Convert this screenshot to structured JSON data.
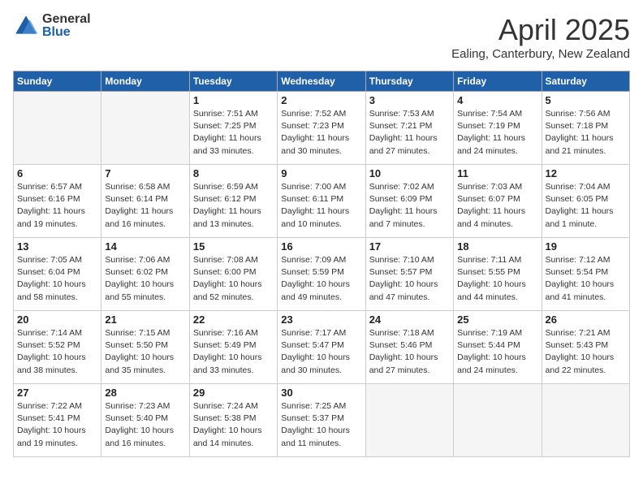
{
  "header": {
    "logo_general": "General",
    "logo_blue": "Blue",
    "month": "April 2025",
    "location": "Ealing, Canterbury, New Zealand"
  },
  "weekdays": [
    "Sunday",
    "Monday",
    "Tuesday",
    "Wednesday",
    "Thursday",
    "Friday",
    "Saturday"
  ],
  "weeks": [
    [
      {
        "day": "",
        "sunrise": "",
        "sunset": "",
        "daylight": ""
      },
      {
        "day": "",
        "sunrise": "",
        "sunset": "",
        "daylight": ""
      },
      {
        "day": "1",
        "sunrise": "Sunrise: 7:51 AM",
        "sunset": "Sunset: 7:25 PM",
        "daylight": "Daylight: 11 hours and 33 minutes."
      },
      {
        "day": "2",
        "sunrise": "Sunrise: 7:52 AM",
        "sunset": "Sunset: 7:23 PM",
        "daylight": "Daylight: 11 hours and 30 minutes."
      },
      {
        "day": "3",
        "sunrise": "Sunrise: 7:53 AM",
        "sunset": "Sunset: 7:21 PM",
        "daylight": "Daylight: 11 hours and 27 minutes."
      },
      {
        "day": "4",
        "sunrise": "Sunrise: 7:54 AM",
        "sunset": "Sunset: 7:19 PM",
        "daylight": "Daylight: 11 hours and 24 minutes."
      },
      {
        "day": "5",
        "sunrise": "Sunrise: 7:56 AM",
        "sunset": "Sunset: 7:18 PM",
        "daylight": "Daylight: 11 hours and 21 minutes."
      }
    ],
    [
      {
        "day": "6",
        "sunrise": "Sunrise: 6:57 AM",
        "sunset": "Sunset: 6:16 PM",
        "daylight": "Daylight: 11 hours and 19 minutes."
      },
      {
        "day": "7",
        "sunrise": "Sunrise: 6:58 AM",
        "sunset": "Sunset: 6:14 PM",
        "daylight": "Daylight: 11 hours and 16 minutes."
      },
      {
        "day": "8",
        "sunrise": "Sunrise: 6:59 AM",
        "sunset": "Sunset: 6:12 PM",
        "daylight": "Daylight: 11 hours and 13 minutes."
      },
      {
        "day": "9",
        "sunrise": "Sunrise: 7:00 AM",
        "sunset": "Sunset: 6:11 PM",
        "daylight": "Daylight: 11 hours and 10 minutes."
      },
      {
        "day": "10",
        "sunrise": "Sunrise: 7:02 AM",
        "sunset": "Sunset: 6:09 PM",
        "daylight": "Daylight: 11 hours and 7 minutes."
      },
      {
        "day": "11",
        "sunrise": "Sunrise: 7:03 AM",
        "sunset": "Sunset: 6:07 PM",
        "daylight": "Daylight: 11 hours and 4 minutes."
      },
      {
        "day": "12",
        "sunrise": "Sunrise: 7:04 AM",
        "sunset": "Sunset: 6:05 PM",
        "daylight": "Daylight: 11 hours and 1 minute."
      }
    ],
    [
      {
        "day": "13",
        "sunrise": "Sunrise: 7:05 AM",
        "sunset": "Sunset: 6:04 PM",
        "daylight": "Daylight: 10 hours and 58 minutes."
      },
      {
        "day": "14",
        "sunrise": "Sunrise: 7:06 AM",
        "sunset": "Sunset: 6:02 PM",
        "daylight": "Daylight: 10 hours and 55 minutes."
      },
      {
        "day": "15",
        "sunrise": "Sunrise: 7:08 AM",
        "sunset": "Sunset: 6:00 PM",
        "daylight": "Daylight: 10 hours and 52 minutes."
      },
      {
        "day": "16",
        "sunrise": "Sunrise: 7:09 AM",
        "sunset": "Sunset: 5:59 PM",
        "daylight": "Daylight: 10 hours and 49 minutes."
      },
      {
        "day": "17",
        "sunrise": "Sunrise: 7:10 AM",
        "sunset": "Sunset: 5:57 PM",
        "daylight": "Daylight: 10 hours and 47 minutes."
      },
      {
        "day": "18",
        "sunrise": "Sunrise: 7:11 AM",
        "sunset": "Sunset: 5:55 PM",
        "daylight": "Daylight: 10 hours and 44 minutes."
      },
      {
        "day": "19",
        "sunrise": "Sunrise: 7:12 AM",
        "sunset": "Sunset: 5:54 PM",
        "daylight": "Daylight: 10 hours and 41 minutes."
      }
    ],
    [
      {
        "day": "20",
        "sunrise": "Sunrise: 7:14 AM",
        "sunset": "Sunset: 5:52 PM",
        "daylight": "Daylight: 10 hours and 38 minutes."
      },
      {
        "day": "21",
        "sunrise": "Sunrise: 7:15 AM",
        "sunset": "Sunset: 5:50 PM",
        "daylight": "Daylight: 10 hours and 35 minutes."
      },
      {
        "day": "22",
        "sunrise": "Sunrise: 7:16 AM",
        "sunset": "Sunset: 5:49 PM",
        "daylight": "Daylight: 10 hours and 33 minutes."
      },
      {
        "day": "23",
        "sunrise": "Sunrise: 7:17 AM",
        "sunset": "Sunset: 5:47 PM",
        "daylight": "Daylight: 10 hours and 30 minutes."
      },
      {
        "day": "24",
        "sunrise": "Sunrise: 7:18 AM",
        "sunset": "Sunset: 5:46 PM",
        "daylight": "Daylight: 10 hours and 27 minutes."
      },
      {
        "day": "25",
        "sunrise": "Sunrise: 7:19 AM",
        "sunset": "Sunset: 5:44 PM",
        "daylight": "Daylight: 10 hours and 24 minutes."
      },
      {
        "day": "26",
        "sunrise": "Sunrise: 7:21 AM",
        "sunset": "Sunset: 5:43 PM",
        "daylight": "Daylight: 10 hours and 22 minutes."
      }
    ],
    [
      {
        "day": "27",
        "sunrise": "Sunrise: 7:22 AM",
        "sunset": "Sunset: 5:41 PM",
        "daylight": "Daylight: 10 hours and 19 minutes."
      },
      {
        "day": "28",
        "sunrise": "Sunrise: 7:23 AM",
        "sunset": "Sunset: 5:40 PM",
        "daylight": "Daylight: 10 hours and 16 minutes."
      },
      {
        "day": "29",
        "sunrise": "Sunrise: 7:24 AM",
        "sunset": "Sunset: 5:38 PM",
        "daylight": "Daylight: 10 hours and 14 minutes."
      },
      {
        "day": "30",
        "sunrise": "Sunrise: 7:25 AM",
        "sunset": "Sunset: 5:37 PM",
        "daylight": "Daylight: 10 hours and 11 minutes."
      },
      {
        "day": "",
        "sunrise": "",
        "sunset": "",
        "daylight": ""
      },
      {
        "day": "",
        "sunrise": "",
        "sunset": "",
        "daylight": ""
      },
      {
        "day": "",
        "sunrise": "",
        "sunset": "",
        "daylight": ""
      }
    ]
  ]
}
